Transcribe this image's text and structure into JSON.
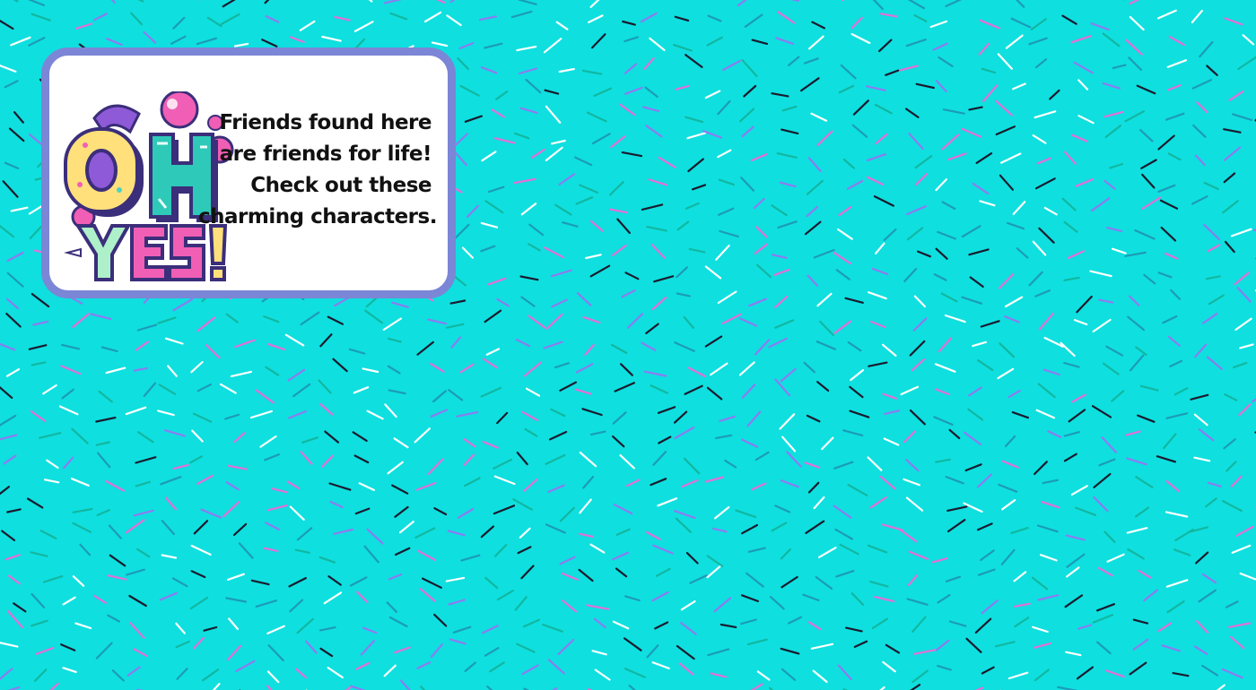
{
  "background": {
    "color": "#0fdfdf",
    "sprinkle_colors": [
      "#ffffff",
      "#1b1b2e",
      "#e36fd6",
      "#12b7a0",
      "#1c9bb8",
      "#8d7bf0"
    ]
  },
  "card": {
    "border_color": "#7b86d6",
    "logo": {
      "text": "OH YES!",
      "icon": "oh-yes-logo-icon"
    },
    "message": {
      "line1": "Friends found here",
      "line2": "are friends for life!",
      "line3": "Check out these",
      "line4": "charming characters."
    }
  }
}
